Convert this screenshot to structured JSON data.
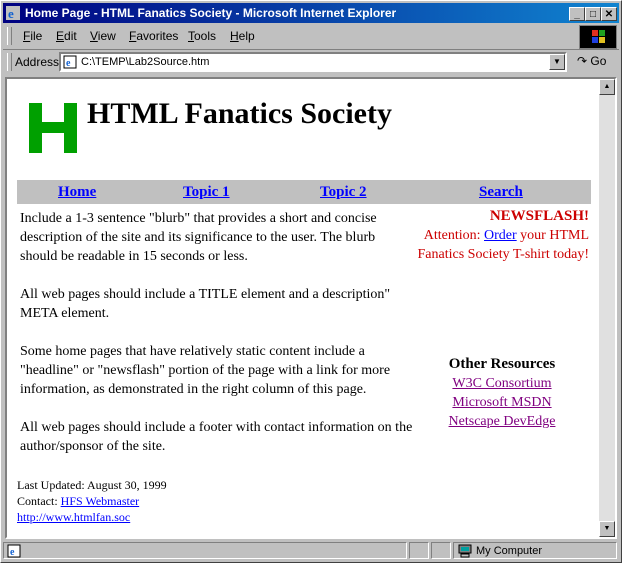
{
  "window": {
    "title": "Home Page - HTML Fanatics Society - Microsoft Internet Explorer"
  },
  "menu": [
    "File",
    "Edit",
    "View",
    "Favorites",
    "Tools",
    "Help"
  ],
  "address": {
    "label": "Address",
    "url": "C:\\TEMP\\Lab2Source.htm",
    "go": "Go"
  },
  "page": {
    "site_title": "HTML Fanatics Society",
    "logo_letter": "H",
    "nav": [
      "Home",
      "Topic 1",
      "Topic 2",
      "Search"
    ],
    "blurbs": [
      "Include a 1-3 sentence \"blurb\" that provides a short and concise description of the site and its significance to the user. The blurb should be readable in 15 seconds or less.",
      "All web pages should include a TITLE element and a description\" META element.",
      "Some home pages that have relatively static content include a \"headline\" or \"newsflash\" portion of the page with a link for more information, as demonstrated in the right column of this page.",
      "All web pages should include a footer with contact information on the author/sponsor of the site."
    ],
    "newsflash": {
      "heading": "NEWSFLASH!",
      "before": "Attention: ",
      "link": "Order",
      "after": " your HTML Fanatics Society T-shirt today!"
    },
    "resources": {
      "heading": "Other Resources",
      "links": [
        "W3C Consortium",
        "Microsoft MSDN",
        "Netscape DevEdge"
      ]
    },
    "footer": {
      "updated": "Last Updated: August 30, 1999",
      "contact_label": "Contact: ",
      "contact_link": "HFS Webmaster",
      "url": "http://www.htmlfan.soc"
    }
  },
  "status": {
    "zone": "My Computer"
  },
  "colors": {
    "logo": "#00a000",
    "title_bar": "#000080",
    "news": "#cc0000",
    "visited": "#800080",
    "link": "#0000ff"
  }
}
